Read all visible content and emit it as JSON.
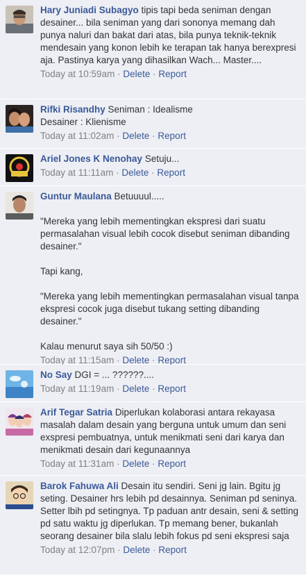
{
  "actions": {
    "delete": "Delete",
    "report": "Report",
    "separator": "·"
  },
  "comments": [
    {
      "author": "Hary Juniadi Subagyo",
      "text": "tipis tapi beda seniman dengan desainer... bila seniman yang dari sononya memang dah punya naluri dan bakat dari atas, bila punya teknik-teknik mendesain yang konon lebih ke terapan tak hanya berexpresi aja. Pastinya karya yang dihasilkan Wach... Master....",
      "time": "Today at 10:59am",
      "avatar_icon": "man-portrait-avatar"
    },
    {
      "author": "Rifki Risandhy",
      "text": "Seniman : Idealisme\nDesainer : Klienisme",
      "time": "Today at 11:02am",
      "avatar_icon": "couple-portrait-avatar"
    },
    {
      "author": "Ariel Jones K Nenohay",
      "text": "Setuju...",
      "time": "Today at 11:11am",
      "avatar_icon": "radio-logo-avatar"
    },
    {
      "author": "Guntur Maulana",
      "text": "Betuuuul.....\n\n\"Mereka yang lebih mementingkan ekspresi dari suatu permasalahan visual lebih cocok disebut seniman dibanding desainer.\"\n\nTapi kang,\n\n\"Mereka yang lebih mementingkan permasalahan visual tanpa ekspresi cocok juga disebut tukang setting dibanding desainer.\"\n\nKalau menurut saya sih 50/50 :)",
      "time": "Today at 11:15am",
      "avatar_icon": "young-man-portrait-avatar"
    },
    {
      "author": "No Say",
      "text": "DGI = ... ??????....",
      "time": "Today at 11:19am",
      "avatar_icon": "blue-sky-avatar"
    },
    {
      "author": "Arif Tegar Satria",
      "text": "Diperlukan kolaborasi antara rekayasa masalah dalam desain yang berguna untuk umum dan seni exspresi pembuatnya, untuk menikmati seni dari karya dan menikmati desain dari kegunaannya",
      "time": "Today at 11:31am",
      "avatar_icon": "anime-characters-avatar"
    },
    {
      "author": "Barok Fahuwa Ali",
      "text": "Desain itu sendiri. Seni jg lain. Bgitu jg seting. Desainer hrs lebih pd desainnya. Seniman pd seninya. Setter lbih pd setingnya. Tp paduan antr desain, seni & setting pd satu waktu jg diperlukan. Tp memang bener, bukanlah seorang desainer bila slalu lebih fokus pd seni ekspresi saja",
      "time": "Today at 12:07pm",
      "avatar_icon": "cartoon-detective-avatar"
    }
  ]
}
